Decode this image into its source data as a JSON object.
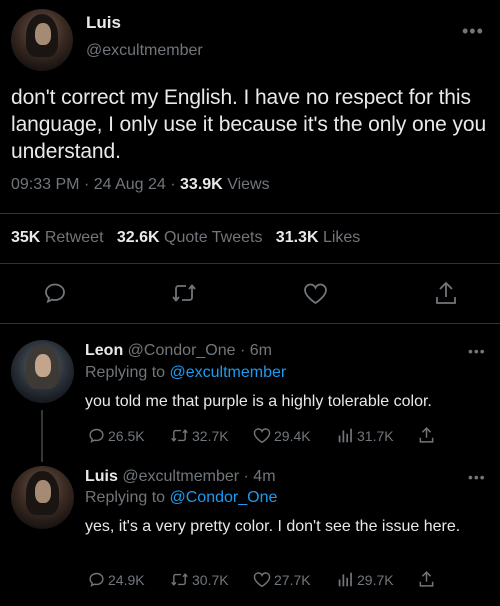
{
  "main_tweet": {
    "display_name": "Luis",
    "handle": "@excultmember",
    "text": "don't correct my English. I have no respect for this language, I only use it because it's the only one you understand.",
    "time": "09:33 PM",
    "sep1": "·",
    "date": "24 Aug 24",
    "sep2": "·",
    "views_count": "33.9K",
    "views_label": "Views",
    "retweet_count": "35K",
    "retweet_label": "Retweet",
    "quote_count": "32.6K",
    "quote_label": "Quote Tweets",
    "likes_count": "31.3K",
    "likes_label": "Likes",
    "more_icon": "more-horizontal-icon"
  },
  "actions": [
    "reply-icon",
    "retweet-icon",
    "like-icon",
    "share-icon"
  ],
  "replies": [
    {
      "display_name": "Leon",
      "handle": "@Condor_One",
      "sep": "·",
      "age": "6m",
      "replying_prefix": "Replying to",
      "replying_to": "@excultmember",
      "text": "you told me that purple is a highly tolerable color.",
      "reply_count": "26.5K",
      "retweet_count": "32.7K",
      "like_count": "29.4K",
      "view_count": "31.7K"
    },
    {
      "display_name": "Luis",
      "handle": "@excultmember",
      "sep": "·",
      "age": "4m",
      "replying_prefix": "Replying to",
      "replying_to": "@Condor_One",
      "text": "yes, it's a very pretty color. I don't see the issue here.",
      "reply_count": "24.9K",
      "retweet_count": "30.7K",
      "like_count": "27.7K",
      "view_count": "29.7K"
    }
  ],
  "colors": {
    "background": "#000000",
    "text": "#e7e9ea",
    "muted": "#71767b",
    "link": "#1d9bf0",
    "divider": "#2f3336"
  }
}
